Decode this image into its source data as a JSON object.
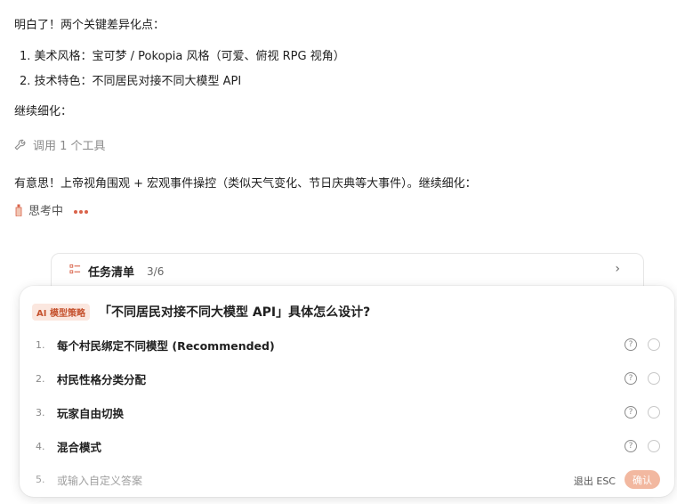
{
  "chat": {
    "intro": "明白了！两个关键差异化点：",
    "points": [
      "1. 美术风格：宝可梦 / Pokopia 风格（可爱、俯视 RPG 视角）",
      "2. 技术特色：不同居民对接不同大模型 API"
    ],
    "continue1": "继续细化：",
    "tool_call": "调用 1 个工具",
    "message2": "有意思！上帝视角围观 + 宏观事件操控（类似天气变化、节日庆典等大事件）。继续细化：",
    "thinking": "思考中"
  },
  "task_list": {
    "title": "任务清单",
    "count": "3/6"
  },
  "question": {
    "badge": "AI 模型策略",
    "title": "「不同居民对接不同大模型 API」具体怎么设计?",
    "options": [
      {
        "num": "1.",
        "label": "每个村民绑定不同模型 (Recommended)"
      },
      {
        "num": "2.",
        "label": "村民性格分类分配"
      },
      {
        "num": "3.",
        "label": "玩家自由切换"
      },
      {
        "num": "4.",
        "label": "混合模式"
      }
    ],
    "custom": {
      "num": "5.",
      "placeholder": "或输入自定义答案"
    },
    "exit_label": "退出 ESC",
    "confirm_label": "确认"
  },
  "colors": {
    "accent": "#d9634a",
    "badge_bg": "#fbe7df",
    "confirm_bg": "#f2b8a0"
  }
}
